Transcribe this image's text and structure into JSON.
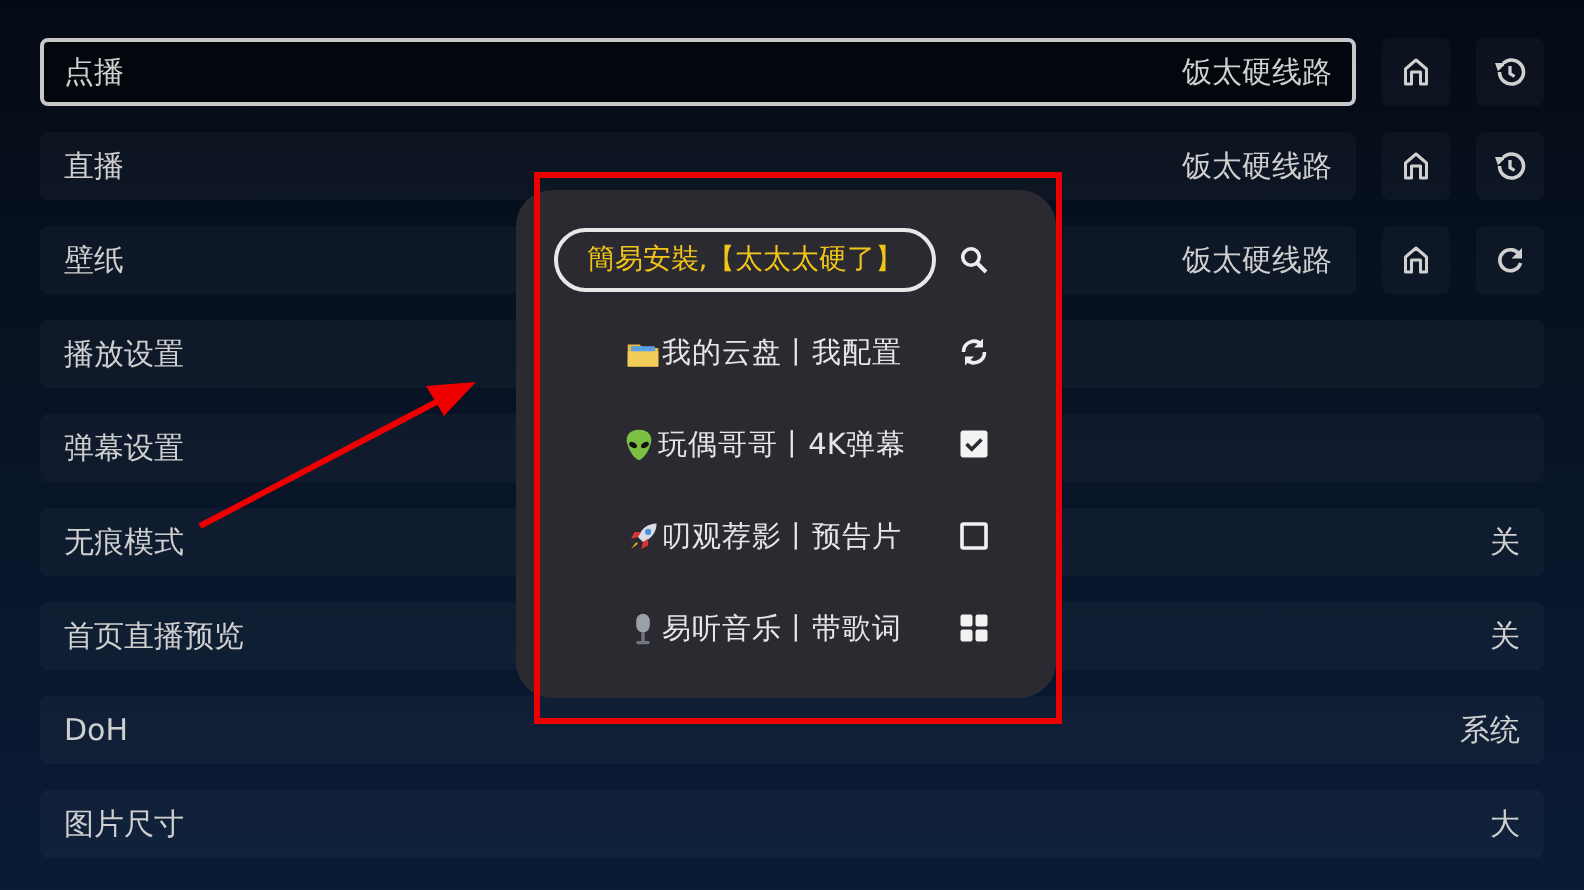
{
  "settings": [
    {
      "label": "点播",
      "value": "饭太硬线路",
      "selected": true,
      "actions": [
        {
          "kind": "home"
        },
        {
          "kind": "history"
        }
      ]
    },
    {
      "label": "直播",
      "value": "饭太硬线路",
      "selected": false,
      "actions": [
        {
          "kind": "home"
        },
        {
          "kind": "history"
        }
      ]
    },
    {
      "label": "壁纸",
      "value": "饭太硬线路",
      "selected": false,
      "actions": [
        {
          "kind": "home"
        },
        {
          "kind": "refresh"
        }
      ]
    },
    {
      "label": "播放设置",
      "selected": false
    },
    {
      "label": "弹幕设置",
      "selected": false
    },
    {
      "label": "无痕模式",
      "value": "关",
      "selected": false
    },
    {
      "label": "首页直播预览",
      "value": "关",
      "selected": false
    },
    {
      "label": "DoH",
      "value": "系统",
      "selected": false
    },
    {
      "label": "图片尺寸",
      "value": "大",
      "selected": false
    }
  ],
  "popup": {
    "search": {
      "value": "簡易安裝,【太太太硬了】"
    },
    "items": [
      {
        "label": "我的云盘丨我配置",
        "kind": "sync"
      },
      {
        "label": "玩偶哥哥丨4K弹幕",
        "kind": "checkbox",
        "checked": true
      },
      {
        "label": "叨观荐影丨预告片",
        "kind": "checkbox",
        "checked": false
      },
      {
        "label": "易听音乐丨带歌词",
        "kind": "grid"
      }
    ]
  }
}
